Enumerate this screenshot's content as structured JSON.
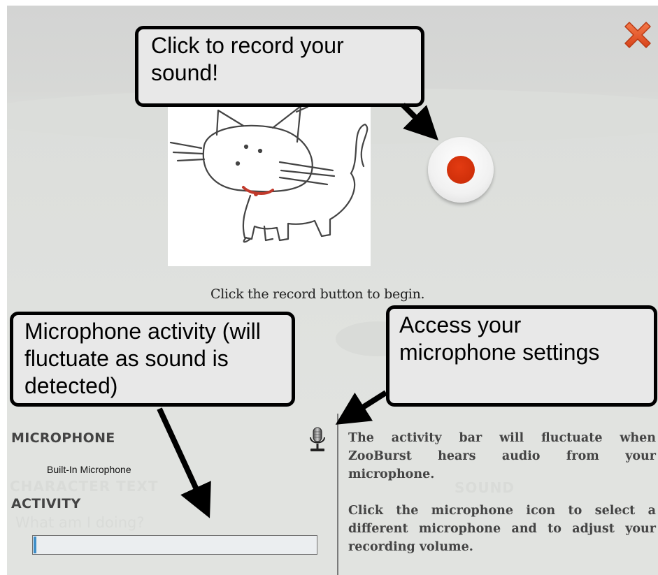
{
  "instruction": "Click the record button to begin.",
  "callouts": {
    "record": [
      "Click to record your",
      "sound!"
    ],
    "activity": [
      "Microphone activity (will",
      "fluctuate as sound is",
      "detected)"
    ],
    "settings": [
      "Access your",
      "microphone settings"
    ]
  },
  "microphone_panel": {
    "microphone_heading": "MICROPHONE",
    "device_name": "Built-In Microphone",
    "activity_heading": "ACTIVITY",
    "activity_level": 0.01
  },
  "help_panel": {
    "paragraph_1": "The activity bar will fluctuate when ZooBurst hears audio from your microphone.",
    "paragraph_2": "Click the microphone icon to select a different microphone and to adjust your recording volume."
  },
  "background_text": {
    "character_text_heading": "CHARACTER TEXT",
    "sound_heading": "SOUND",
    "placeholder": "What am I doing?"
  },
  "icons": {
    "close": "close-icon",
    "record": "record-icon",
    "microphone": "microphone-icon"
  },
  "colors": {
    "record_red": "#d5350c",
    "close_orange": "#e9552b",
    "activity_blue": "#3f8fc8"
  }
}
